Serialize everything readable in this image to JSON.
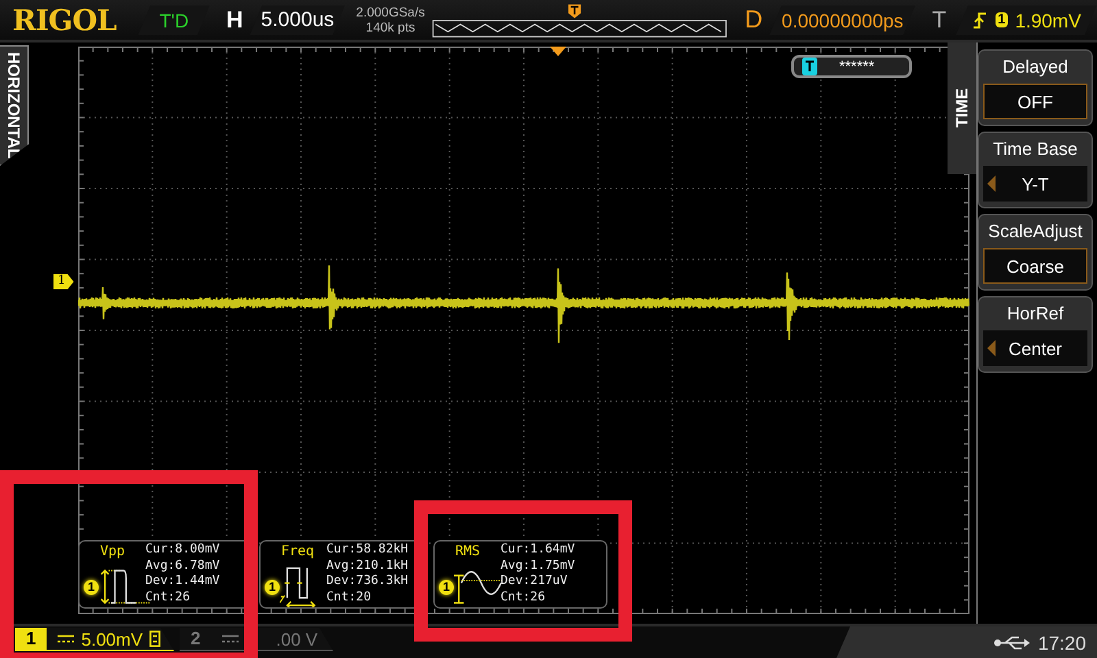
{
  "top_bar": {
    "brand": "RIGOL",
    "run_state": "T'D",
    "timebase_label": "H",
    "timebase": "5.000us",
    "sample_rate": "2.000GSa/s",
    "memory_depth": "140k pts",
    "delay_label": "D",
    "delay": "0.00000000ps",
    "trigger_label": "T",
    "trigger_source": "1",
    "trigger_level": "1.90mV"
  },
  "side_tab": {
    "label": "HORIZONTAL"
  },
  "screen": {
    "channel_marker": "1",
    "status_field": "******"
  },
  "measurements": [
    {
      "name": "Vpp",
      "channel": "1",
      "lines": [
        "Cur:8.00mV",
        "Avg:6.78mV",
        "Dev:1.44mV",
        "Cnt:26"
      ]
    },
    {
      "name": "Freq",
      "channel": "1",
      "lines": [
        "Cur:58.82kH",
        "Avg:210.1kH",
        "Dev:736.3kH",
        "Cnt:20"
      ]
    },
    {
      "name": "RMS",
      "channel": "1",
      "lines": [
        "Cur:1.64mV",
        "Avg:1.75mV",
        "Dev:217uV",
        "Cnt:26"
      ]
    }
  ],
  "menu": {
    "title": "TIME",
    "items": [
      {
        "label": "Delayed",
        "value": "OFF",
        "kind": "box"
      },
      {
        "label": "Time Base",
        "value": "Y-T",
        "kind": "arrow"
      },
      {
        "label": "ScaleAdjust",
        "value": "Coarse",
        "kind": "box"
      },
      {
        "label": "HorRef",
        "value": "Center",
        "kind": "arrow"
      }
    ]
  },
  "channels": [
    {
      "number": "1",
      "scale": "5.00mV",
      "on": true
    },
    {
      "number": "2",
      "scale": ".00 V",
      "on": false
    }
  ],
  "status_bar": {
    "time": "17:20"
  }
}
